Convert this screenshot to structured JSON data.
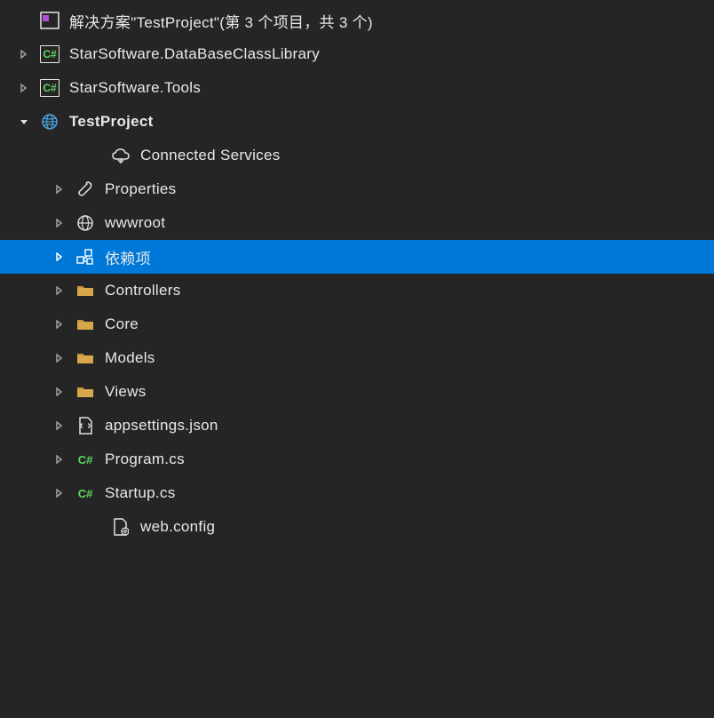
{
  "solution": {
    "label": "解决方案\"TestProject\"(第 3 个项目，共 3 个)"
  },
  "projects": {
    "project1": {
      "label": "StarSoftware.DataBaseClassLibrary"
    },
    "project2": {
      "label": "StarSoftware.Tools"
    },
    "project3": {
      "label": "TestProject"
    }
  },
  "nodes": {
    "connectedServices": {
      "label": "Connected Services"
    },
    "properties": {
      "label": "Properties"
    },
    "wwwroot": {
      "label": "wwwroot"
    },
    "dependencies": {
      "label": "依赖项"
    },
    "controllers": {
      "label": "Controllers"
    },
    "core": {
      "label": "Core"
    },
    "models": {
      "label": "Models"
    },
    "views": {
      "label": "Views"
    },
    "appsettings": {
      "label": "appsettings.json"
    },
    "program": {
      "label": "Program.cs"
    },
    "startup": {
      "label": "Startup.cs"
    },
    "webconfig": {
      "label": "web.config"
    }
  }
}
